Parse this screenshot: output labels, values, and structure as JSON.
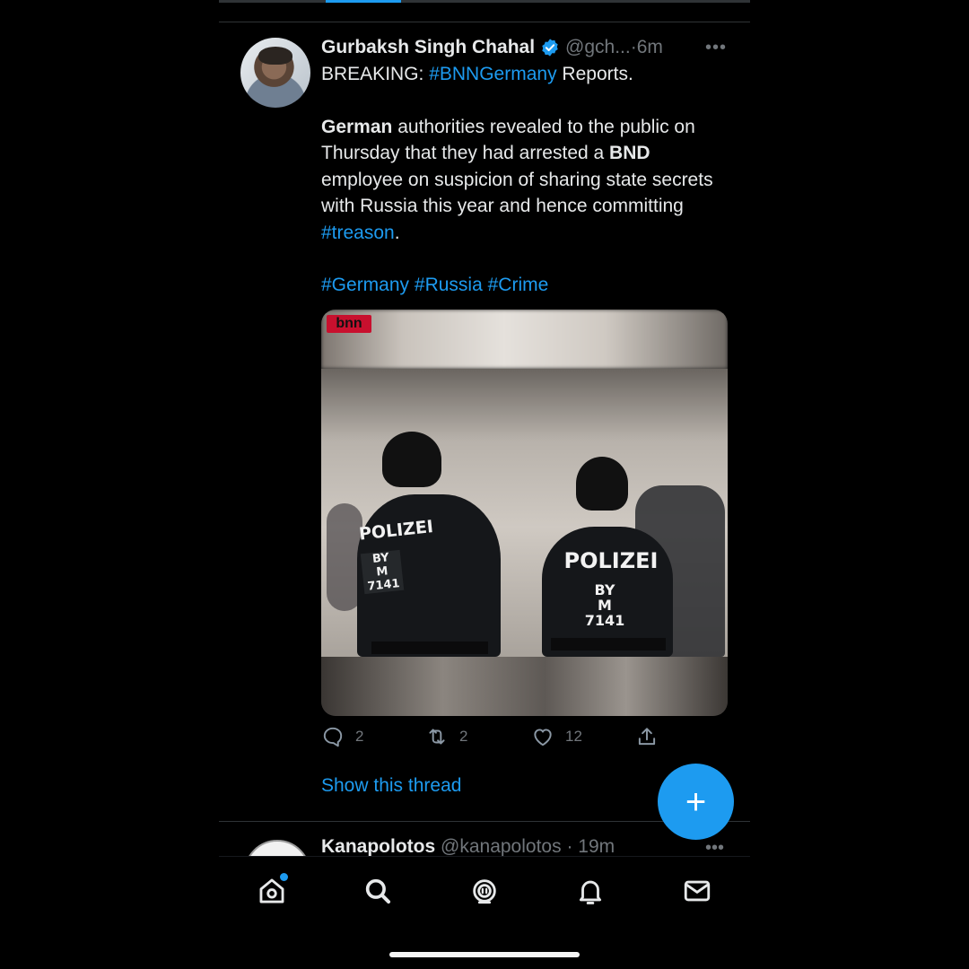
{
  "tweet": {
    "author_name": "Gurbaksh Singh Chahal",
    "handle": "@gch...",
    "dot": "·",
    "time": "6m",
    "more": "•••",
    "line1_prefix": "BREAKING: ",
    "line1_hashtag": "#BNNGermany",
    "line1_suffix": " Reports.",
    "p2_bold1": "German",
    "p2_text1": " authorities revealed to the public on Thursday that they had arrested a ",
    "p2_bold2": "BND",
    "p2_text2": " employee on suspicion of sharing state secrets with Russia this year and hence committing ",
    "p2_hashtag": "#treason",
    "p2_end": ".",
    "tags": [
      "#Germany",
      "#Russia",
      "#Crime"
    ],
    "media": {
      "watermark": "bnn",
      "patch_left_title": "POLIZEI",
      "patch_left_sub1": "BY",
      "patch_left_sub2": "M 7141",
      "patch_right_title": "POLIZEI",
      "patch_right_sub1": "BY",
      "patch_right_sub2": "M 7141"
    },
    "actions": {
      "reply_count": "2",
      "retweet_count": "2",
      "like_count": "12"
    },
    "show_thread": "Show this thread"
  },
  "fab": {
    "label": "+"
  },
  "next_tweet": {
    "author_name": "Kanapolotos",
    "handle": "@kanapolotos",
    "dot": "·",
    "time": "19m",
    "more": "•••"
  },
  "tabbar": {
    "icons": [
      "home-icon",
      "search-icon",
      "spaces-icon",
      "notifications-icon",
      "messages-icon"
    ],
    "accent": "#1d9bf0"
  },
  "colors": {
    "background": "#000000",
    "text": "#e7e9ea",
    "secondary": "#71767b",
    "link": "#1d9bf0"
  }
}
